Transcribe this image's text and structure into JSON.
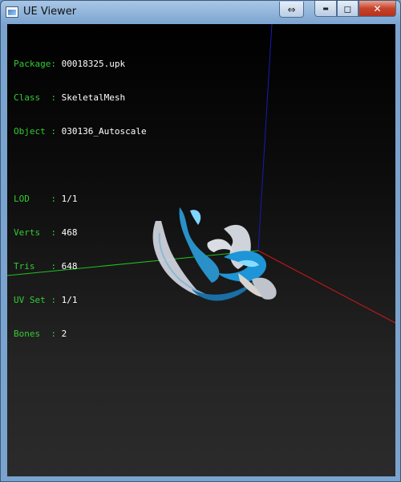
{
  "window": {
    "title": "UE Viewer"
  },
  "titlebar_buttons": {
    "resize_glyph": "⇔",
    "minimize_glyph": "▬",
    "maximize_glyph": "◻",
    "close_glyph": "✕"
  },
  "info_panel": {
    "package_label": "Package:",
    "package_value": "00018325.upk",
    "class_label": "Class  :",
    "class_value": "SkeletalMesh",
    "object_label": "Object :",
    "object_value": "030136_Autoscale",
    "lod_label": "LOD    :",
    "lod_value": "1/1",
    "verts_label": "Verts  :",
    "verts_value": "468",
    "tris_label": "Tris   :",
    "tris_value": "648",
    "uvset_label": "UV Set :",
    "uvset_value": "1/1",
    "bones_label": "Bones  :",
    "bones_value": "2"
  },
  "axes": {
    "x_axis_color": "#d01818",
    "y_axis_color": "#22c022",
    "z_axis_color": "#1a1ab8"
  },
  "mesh": {
    "primary_color": "#1f8fd0",
    "highlight_color": "#7fd6ff",
    "secondary_color": "#c8c8cc"
  }
}
